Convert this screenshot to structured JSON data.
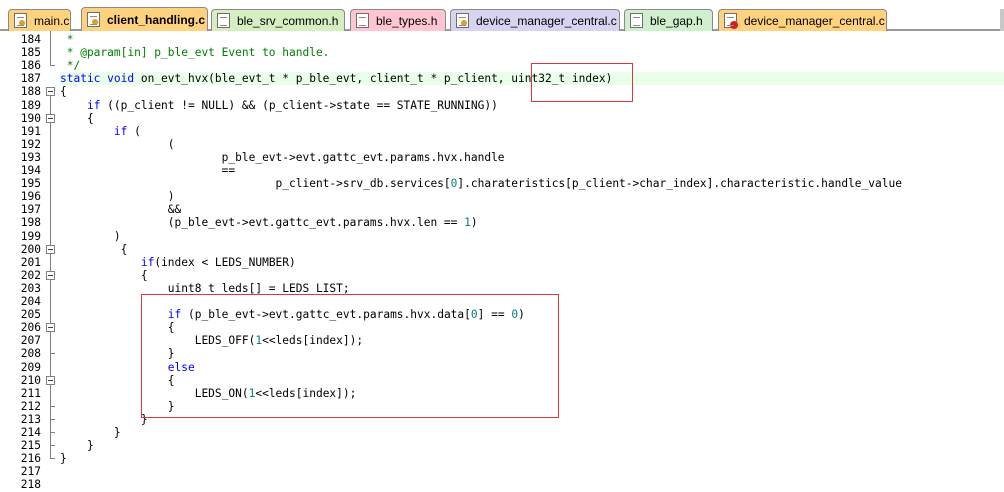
{
  "tabs": [
    {
      "label": "main.c",
      "icon": "c-file-icon",
      "color": "#ffd27f"
    },
    {
      "label": "client_handling.c",
      "icon": "c-file-icon",
      "color": "#ffd27f",
      "active": true
    },
    {
      "label": "ble_srv_common.h",
      "icon": "h-file-icon",
      "color": "#d6efc1"
    },
    {
      "label": "ble_types.h",
      "icon": "h-file-icon",
      "color": "#ffc6d2"
    },
    {
      "label": "device_manager_central.c",
      "icon": "c-file-icon",
      "color": "#d9d3f2"
    },
    {
      "label": "ble_gap.h",
      "icon": "h-file-icon",
      "color": "#d0efcf"
    },
    {
      "label": "device_manager_central.c",
      "icon": "c-file-error-icon",
      "color": "#ffd27f"
    }
  ],
  "colors": {
    "comment": "#008000",
    "keyword": "#0000ff",
    "number": "#008080",
    "highlight": "#eaffea",
    "annotation": "#d43a3a"
  },
  "lines": [
    {
      "n": "184",
      "parts": [
        [
          " *",
          "cm"
        ]
      ]
    },
    {
      "n": "185",
      "parts": [
        [
          " * @param[in] p_ble_evt Event to handle.",
          "cm"
        ]
      ]
    },
    {
      "n": "186",
      "parts": [
        [
          " */",
          "cm"
        ]
      ]
    },
    {
      "n": "187",
      "hl": true,
      "parts": [
        [
          "static void",
          "kw"
        ],
        [
          " on_evt_hvx(ble_evt_t * p_ble_evt, client_t * p_client, uint32_t index)",
          ""
        ]
      ]
    },
    {
      "n": "188",
      "parts": [
        [
          "{",
          ""
        ]
      ]
    },
    {
      "n": "189",
      "parts": [
        [
          "    ",
          ""
        ],
        [
          "if",
          "kw"
        ],
        [
          " ((p_client != NULL) && (p_client->state == STATE_RUNNING))",
          ""
        ]
      ]
    },
    {
      "n": "190",
      "parts": [
        [
          "    {",
          ""
        ]
      ]
    },
    {
      "n": "191",
      "parts": [
        [
          "        ",
          ""
        ],
        [
          "if",
          "kw"
        ],
        [
          " (",
          ""
        ]
      ]
    },
    {
      "n": "192",
      "parts": [
        [
          "                (",
          ""
        ]
      ]
    },
    {
      "n": "193",
      "parts": [
        [
          "                        p_ble_evt->evt.gattc_evt.params.hvx.handle",
          ""
        ]
      ]
    },
    {
      "n": "194",
      "parts": [
        [
          "                        ==",
          ""
        ]
      ]
    },
    {
      "n": "195",
      "parts": [
        [
          "                                p_client->srv_db.services[",
          ""
        ],
        [
          "0",
          "num"
        ],
        [
          "].charateristics[p_client->char_index].characteristic.handle_value",
          ""
        ]
      ]
    },
    {
      "n": "196",
      "parts": [
        [
          "                )",
          ""
        ]
      ]
    },
    {
      "n": "197",
      "parts": [
        [
          "                &&",
          ""
        ]
      ]
    },
    {
      "n": "198",
      "parts": [
        [
          "                (p_ble_evt->evt.gattc_evt.params.hvx.len == ",
          ""
        ],
        [
          "1",
          "num"
        ],
        [
          ")",
          ""
        ]
      ]
    },
    {
      "n": "199",
      "parts": [
        [
          "        )",
          ""
        ]
      ]
    },
    {
      "n": "200",
      "parts": [
        [
          "         {",
          ""
        ]
      ]
    },
    {
      "n": "201",
      "parts": [
        [
          "            ",
          ""
        ],
        [
          "if",
          "kw"
        ],
        [
          "(index < LEDS_NUMBER)",
          ""
        ]
      ]
    },
    {
      "n": "202",
      "parts": [
        [
          "            {",
          ""
        ]
      ]
    },
    {
      "n": "203",
      "parts": [
        [
          "                uint8_t leds[] = LEDS_LIST;",
          ""
        ]
      ]
    },
    {
      "n": "204",
      "parts": []
    },
    {
      "n": "205",
      "parts": [
        [
          "                ",
          ""
        ],
        [
          "if",
          "kw"
        ],
        [
          " (p_ble_evt->evt.gattc_evt.params.hvx.data[",
          ""
        ],
        [
          "0",
          "num"
        ],
        [
          "] == ",
          ""
        ],
        [
          "0",
          "num"
        ],
        [
          ")",
          ""
        ]
      ]
    },
    {
      "n": "206",
      "parts": [
        [
          "                {",
          ""
        ]
      ]
    },
    {
      "n": "207",
      "parts": [
        [
          "                    LEDS_OFF(",
          ""
        ],
        [
          "1",
          "num"
        ],
        [
          "<<leds[index]);",
          ""
        ]
      ]
    },
    {
      "n": "208",
      "parts": [
        [
          "                }",
          ""
        ]
      ]
    },
    {
      "n": "209",
      "parts": [
        [
          "                ",
          ""
        ],
        [
          "else",
          "kw"
        ]
      ]
    },
    {
      "n": "210",
      "parts": [
        [
          "                {",
          ""
        ]
      ]
    },
    {
      "n": "211",
      "parts": [
        [
          "                    LEDS_ON(",
          ""
        ],
        [
          "1",
          "num"
        ],
        [
          "<<leds[index]);",
          ""
        ]
      ]
    },
    {
      "n": "212",
      "parts": [
        [
          "                }",
          ""
        ]
      ]
    },
    {
      "n": "213",
      "parts": [
        [
          "            }",
          ""
        ]
      ]
    },
    {
      "n": "214",
      "parts": [
        [
          "        }",
          ""
        ]
      ]
    },
    {
      "n": "215",
      "parts": [
        [
          "    }",
          ""
        ]
      ]
    },
    {
      "n": "216",
      "parts": [
        [
          "}",
          ""
        ]
      ]
    },
    {
      "n": "217",
      "parts": []
    },
    {
      "n": "218",
      "parts": []
    }
  ]
}
